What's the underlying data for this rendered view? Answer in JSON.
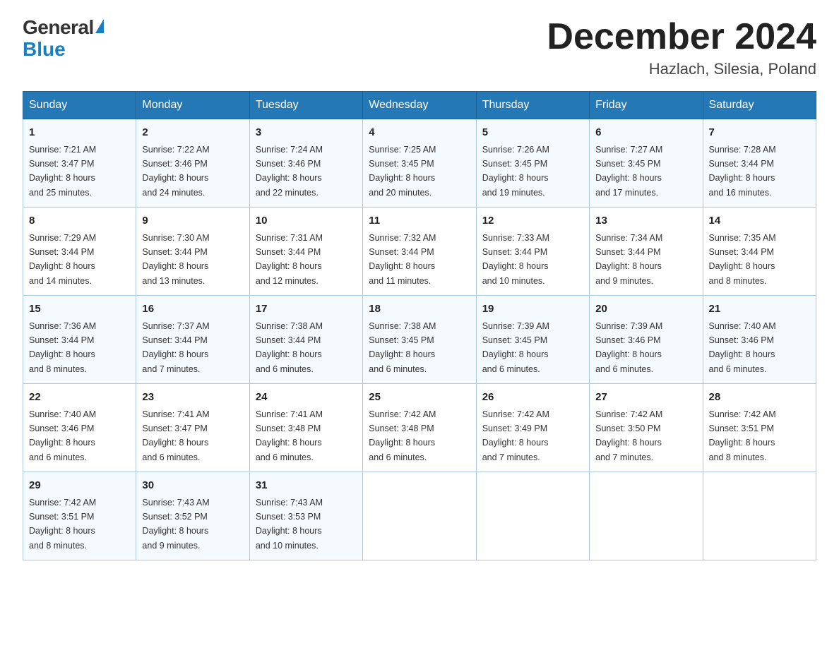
{
  "logo": {
    "general": "General",
    "blue": "Blue",
    "alt": "GeneralBlue logo"
  },
  "header": {
    "title": "December 2024",
    "subtitle": "Hazlach, Silesia, Poland"
  },
  "columns": [
    "Sunday",
    "Monday",
    "Tuesday",
    "Wednesday",
    "Thursday",
    "Friday",
    "Saturday"
  ],
  "weeks": [
    [
      {
        "day": "1",
        "sunrise": "7:21 AM",
        "sunset": "3:47 PM",
        "daylight": "8 hours and 25 minutes."
      },
      {
        "day": "2",
        "sunrise": "7:22 AM",
        "sunset": "3:46 PM",
        "daylight": "8 hours and 24 minutes."
      },
      {
        "day": "3",
        "sunrise": "7:24 AM",
        "sunset": "3:46 PM",
        "daylight": "8 hours and 22 minutes."
      },
      {
        "day": "4",
        "sunrise": "7:25 AM",
        "sunset": "3:45 PM",
        "daylight": "8 hours and 20 minutes."
      },
      {
        "day": "5",
        "sunrise": "7:26 AM",
        "sunset": "3:45 PM",
        "daylight": "8 hours and 19 minutes."
      },
      {
        "day": "6",
        "sunrise": "7:27 AM",
        "sunset": "3:45 PM",
        "daylight": "8 hours and 17 minutes."
      },
      {
        "day": "7",
        "sunrise": "7:28 AM",
        "sunset": "3:44 PM",
        "daylight": "8 hours and 16 minutes."
      }
    ],
    [
      {
        "day": "8",
        "sunrise": "7:29 AM",
        "sunset": "3:44 PM",
        "daylight": "8 hours and 14 minutes."
      },
      {
        "day": "9",
        "sunrise": "7:30 AM",
        "sunset": "3:44 PM",
        "daylight": "8 hours and 13 minutes."
      },
      {
        "day": "10",
        "sunrise": "7:31 AM",
        "sunset": "3:44 PM",
        "daylight": "8 hours and 12 minutes."
      },
      {
        "day": "11",
        "sunrise": "7:32 AM",
        "sunset": "3:44 PM",
        "daylight": "8 hours and 11 minutes."
      },
      {
        "day": "12",
        "sunrise": "7:33 AM",
        "sunset": "3:44 PM",
        "daylight": "8 hours and 10 minutes."
      },
      {
        "day": "13",
        "sunrise": "7:34 AM",
        "sunset": "3:44 PM",
        "daylight": "8 hours and 9 minutes."
      },
      {
        "day": "14",
        "sunrise": "7:35 AM",
        "sunset": "3:44 PM",
        "daylight": "8 hours and 8 minutes."
      }
    ],
    [
      {
        "day": "15",
        "sunrise": "7:36 AM",
        "sunset": "3:44 PM",
        "daylight": "8 hours and 8 minutes."
      },
      {
        "day": "16",
        "sunrise": "7:37 AM",
        "sunset": "3:44 PM",
        "daylight": "8 hours and 7 minutes."
      },
      {
        "day": "17",
        "sunrise": "7:38 AM",
        "sunset": "3:44 PM",
        "daylight": "8 hours and 6 minutes."
      },
      {
        "day": "18",
        "sunrise": "7:38 AM",
        "sunset": "3:45 PM",
        "daylight": "8 hours and 6 minutes."
      },
      {
        "day": "19",
        "sunrise": "7:39 AM",
        "sunset": "3:45 PM",
        "daylight": "8 hours and 6 minutes."
      },
      {
        "day": "20",
        "sunrise": "7:39 AM",
        "sunset": "3:46 PM",
        "daylight": "8 hours and 6 minutes."
      },
      {
        "day": "21",
        "sunrise": "7:40 AM",
        "sunset": "3:46 PM",
        "daylight": "8 hours and 6 minutes."
      }
    ],
    [
      {
        "day": "22",
        "sunrise": "7:40 AM",
        "sunset": "3:46 PM",
        "daylight": "8 hours and 6 minutes."
      },
      {
        "day": "23",
        "sunrise": "7:41 AM",
        "sunset": "3:47 PM",
        "daylight": "8 hours and 6 minutes."
      },
      {
        "day": "24",
        "sunrise": "7:41 AM",
        "sunset": "3:48 PM",
        "daylight": "8 hours and 6 minutes."
      },
      {
        "day": "25",
        "sunrise": "7:42 AM",
        "sunset": "3:48 PM",
        "daylight": "8 hours and 6 minutes."
      },
      {
        "day": "26",
        "sunrise": "7:42 AM",
        "sunset": "3:49 PM",
        "daylight": "8 hours and 7 minutes."
      },
      {
        "day": "27",
        "sunrise": "7:42 AM",
        "sunset": "3:50 PM",
        "daylight": "8 hours and 7 minutes."
      },
      {
        "day": "28",
        "sunrise": "7:42 AM",
        "sunset": "3:51 PM",
        "daylight": "8 hours and 8 minutes."
      }
    ],
    [
      {
        "day": "29",
        "sunrise": "7:42 AM",
        "sunset": "3:51 PM",
        "daylight": "8 hours and 8 minutes."
      },
      {
        "day": "30",
        "sunrise": "7:43 AM",
        "sunset": "3:52 PM",
        "daylight": "8 hours and 9 minutes."
      },
      {
        "day": "31",
        "sunrise": "7:43 AM",
        "sunset": "3:53 PM",
        "daylight": "8 hours and 10 minutes."
      },
      null,
      null,
      null,
      null
    ]
  ],
  "labels": {
    "sunrise": "Sunrise:",
    "sunset": "Sunset:",
    "daylight": "Daylight:"
  }
}
